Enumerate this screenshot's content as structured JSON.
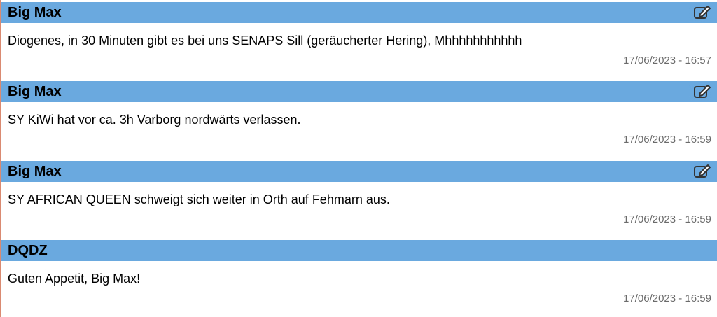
{
  "posts": [
    {
      "author": "Big Max",
      "message": "Diogenes, in 30 Minuten gibt es bei uns SENAPS Sill (geräucherter Hering), Mhhhhhhhhhhh",
      "timestamp": "17/06/2023 - 16:57",
      "editable": true
    },
    {
      "author": "Big Max",
      "message": "SY KiWi hat vor ca. 3h Varborg nordwärts verlassen.",
      "timestamp": "17/06/2023 - 16:59",
      "editable": true
    },
    {
      "author": "Big Max",
      "message": "SY AFRICAN QUEEN schweigt sich weiter in Orth auf Fehmarn aus.",
      "timestamp": "17/06/2023 - 16:59",
      "editable": true
    },
    {
      "author": "DQDZ",
      "message": "Guten Appetit, Big Max!",
      "timestamp": "17/06/2023 - 16:59",
      "editable": false
    }
  ],
  "icons": {
    "edit": "edit-icon"
  },
  "colors": {
    "header_bg": "#6aa9df",
    "timestamp": "#6b6b6b"
  }
}
